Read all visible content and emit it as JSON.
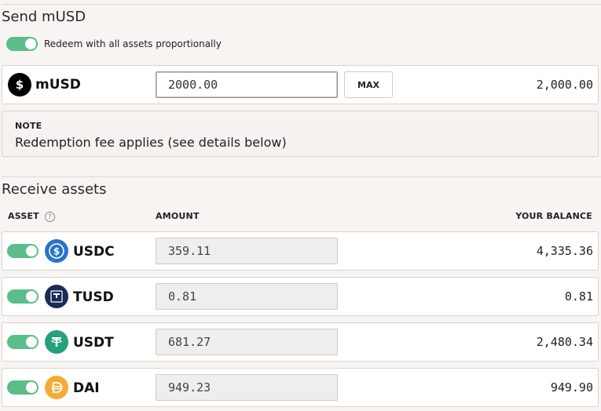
{
  "send": {
    "title": "Send mUSD",
    "redeem_toggle_label": "Redeem with all assets proportionally",
    "token": "mUSD",
    "input_value": "2000.00",
    "max_label": "MAX",
    "balance": "2,000.00"
  },
  "note": {
    "heading": "NOTE",
    "text": "Redemption fee applies (see details below)"
  },
  "receive": {
    "title": "Receive assets",
    "headers": {
      "asset": "ASSET",
      "amount": "AMOUNT",
      "balance": "YOUR BALANCE"
    },
    "help_glyph": "?",
    "assets": [
      {
        "name": "USDC",
        "amount": "359.11",
        "balance": "4,335.36",
        "icon": "usdc-icon",
        "color": "#2775ca"
      },
      {
        "name": "TUSD",
        "amount": "0.81",
        "balance": "0.81",
        "icon": "tusd-icon",
        "color": "#1a2a5a"
      },
      {
        "name": "USDT",
        "amount": "681.27",
        "balance": "2,480.34",
        "icon": "usdt-icon",
        "color": "#26a17b"
      },
      {
        "name": "DAI",
        "amount": "949.23",
        "balance": "949.90",
        "icon": "dai-icon",
        "color": "#f5ac37"
      }
    ]
  },
  "colors": {
    "toggle_on": "#5bbe8a",
    "background": "#f7f4f1"
  }
}
